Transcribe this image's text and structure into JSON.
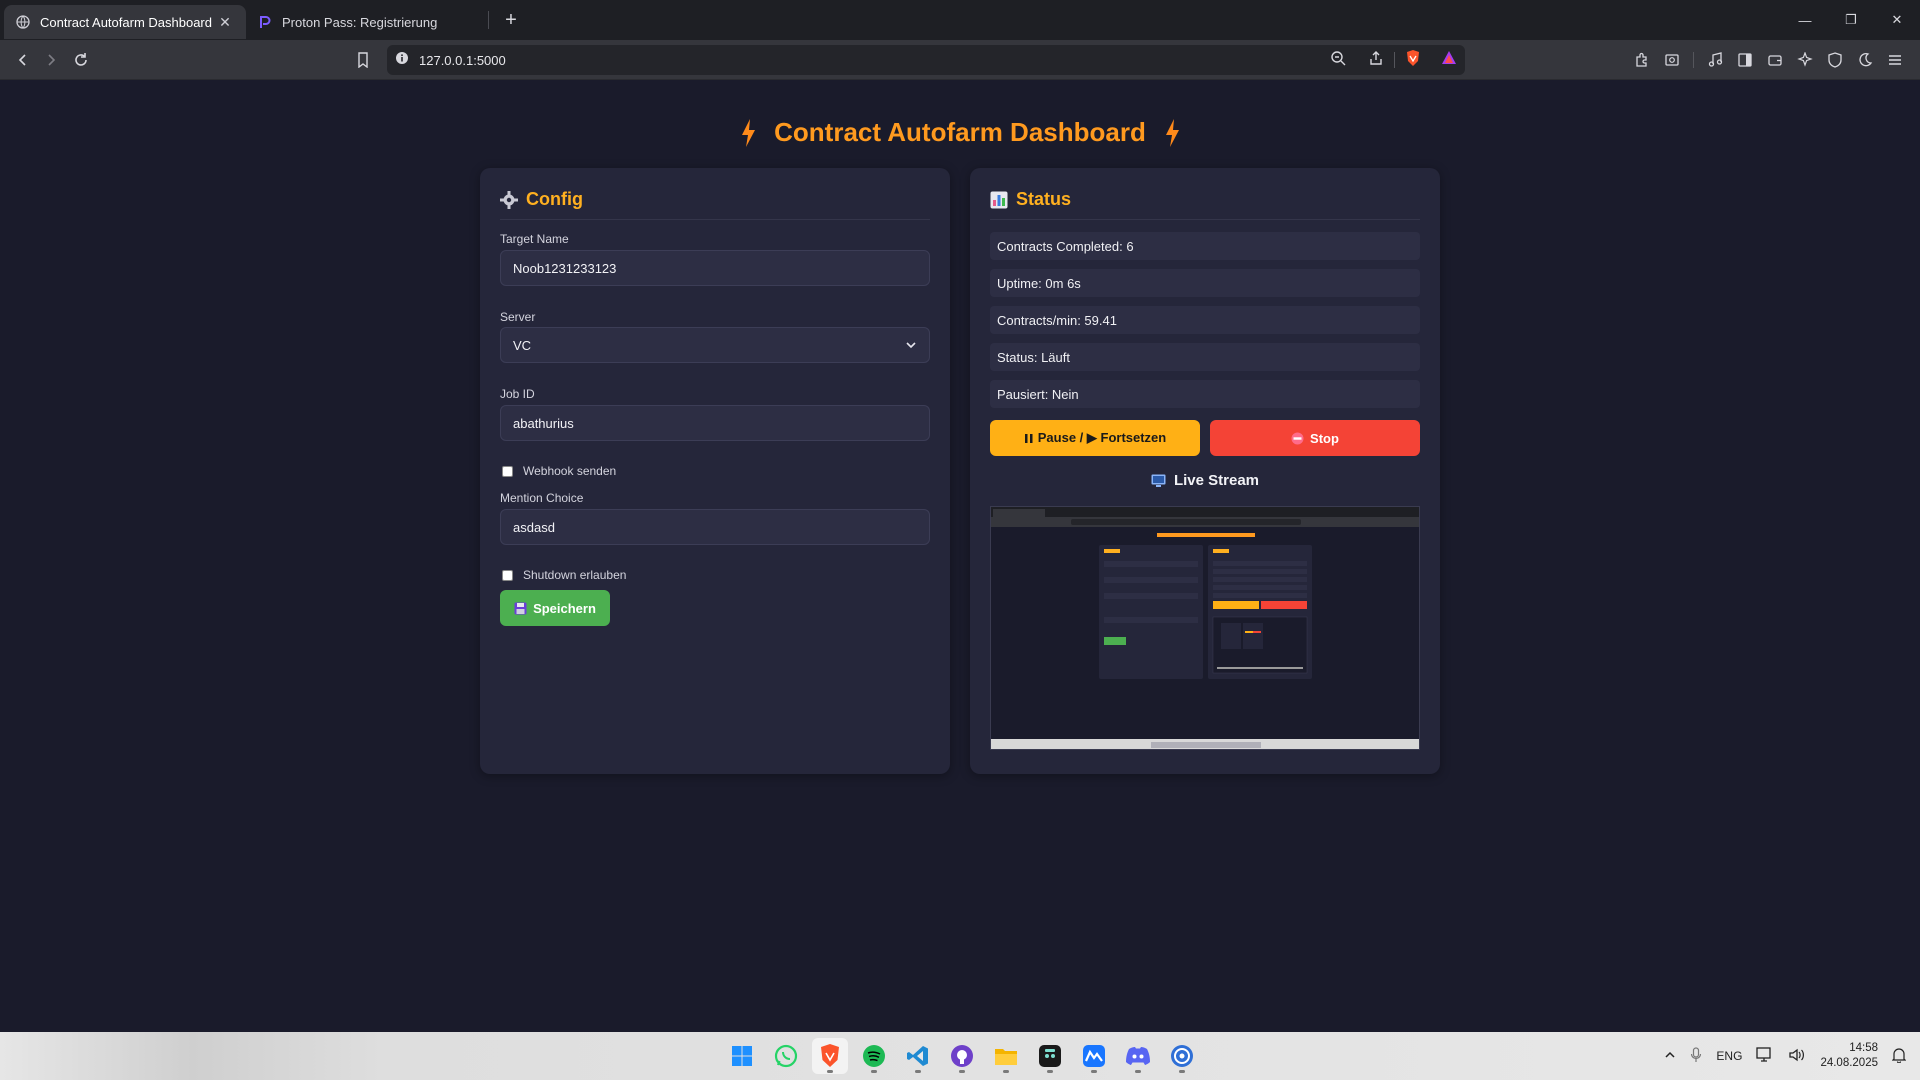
{
  "browser": {
    "tabs": [
      {
        "title": "Contract Autofarm Dashboard",
        "active": true,
        "favicon": "globe-icon"
      },
      {
        "title": "Proton Pass: Registrierung",
        "active": false,
        "favicon": "proton-icon"
      }
    ],
    "url": "127.0.0.1:5000"
  },
  "page": {
    "title": "Contract Autofarm Dashboard",
    "accent": "#ff9a1f"
  },
  "config": {
    "heading": "Config",
    "target_name_label": "Target Name",
    "target_name_value": "Noob1231233123",
    "server_label": "Server",
    "server_value": "VC",
    "job_id_label": "Job ID",
    "job_id_value": "abathurius",
    "webhook_label": "Webhook senden",
    "webhook_checked": false,
    "mention_label": "Mention Choice",
    "mention_value": "asdasd",
    "shutdown_label": "Shutdown erlauben",
    "shutdown_checked": false,
    "save_label": "Speichern"
  },
  "status": {
    "heading": "Status",
    "rows": [
      "Contracts Completed: 6",
      "Uptime: 0m 6s",
      "Contracts/min: 59.41",
      "Status: Läuft",
      "Pausiert: Nein"
    ],
    "pause_label": "Pause / ▶ Fortsetzen",
    "stop_label": "Stop",
    "stream_title": "Live Stream"
  },
  "taskbar": {
    "apps": [
      "windows-start-icon",
      "whatsapp-icon",
      "brave-icon",
      "spotify-icon",
      "vscode-icon",
      "github-icon",
      "file-explorer-icon",
      "chatgpt-icon",
      "maps-icon",
      "discord-icon",
      "app-icon"
    ],
    "language": "ENG",
    "time": "14:58",
    "date": "24.08.2025"
  },
  "colors": {
    "background": "#1a1b2b",
    "card": "#25263a",
    "save": "#4caf50",
    "pause": "#ffb015",
    "stop": "#f44336"
  }
}
